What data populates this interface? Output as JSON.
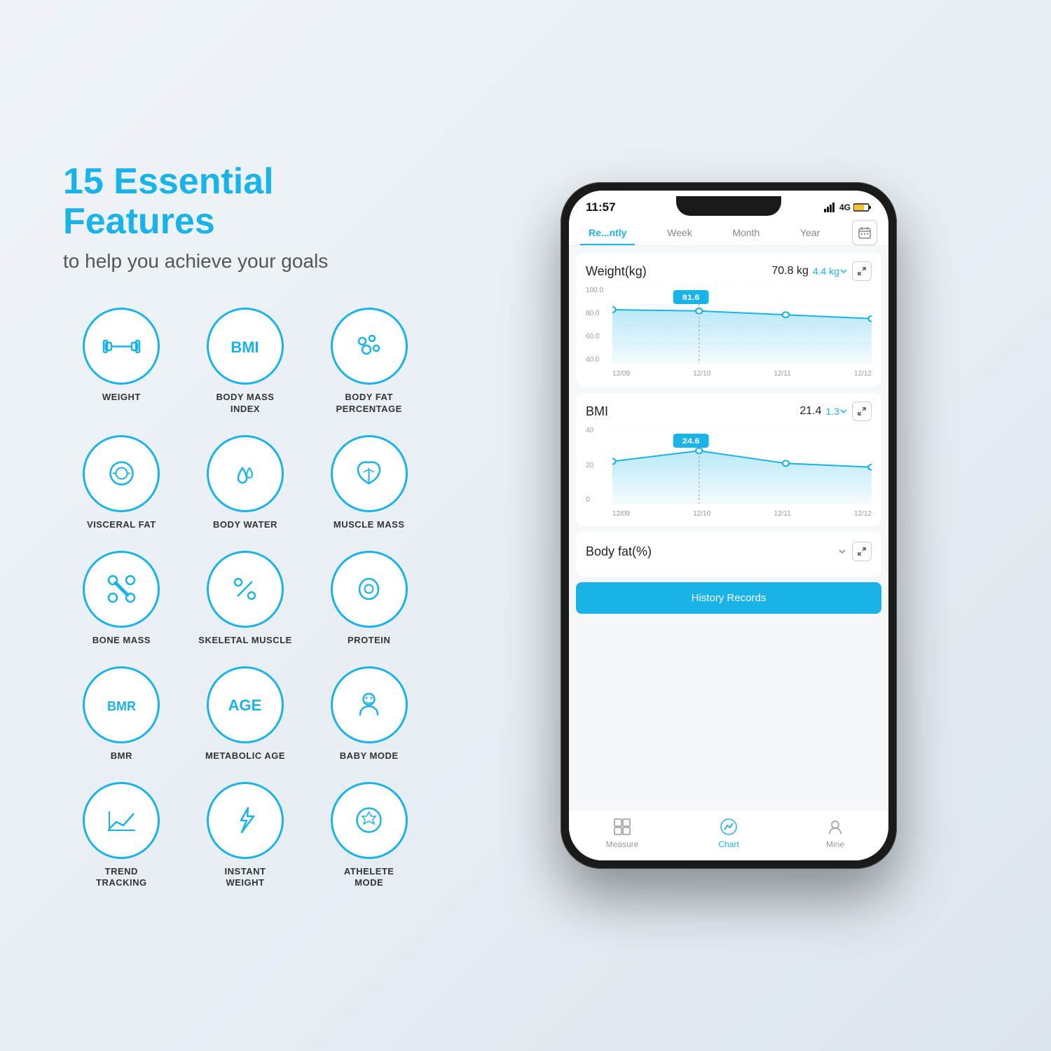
{
  "page": {
    "bg_note": "light gray gradient background"
  },
  "left": {
    "headline": "15 Essential Features",
    "subheadline": "to help you achieve your goals",
    "features": [
      {
        "id": "weight",
        "label": "WEIGHT",
        "icon": "barbell"
      },
      {
        "id": "bmi",
        "label": "BODY MASS\nINDEX",
        "icon": "BMI"
      },
      {
        "id": "bodyfat",
        "label": "BODY FAT\nPERCENTAGE",
        "icon": "dots"
      },
      {
        "id": "visceralfat",
        "label": "VISCERAL FAT",
        "icon": "tape"
      },
      {
        "id": "bodywater",
        "label": "BODY WATER",
        "icon": "drops"
      },
      {
        "id": "musclemass",
        "label": "MUSCLE MASS",
        "icon": "leaf"
      },
      {
        "id": "bonemass",
        "label": "BONE MASS",
        "icon": "bone"
      },
      {
        "id": "skeletal",
        "label": "SKELETAL MUSCLE",
        "icon": "percent"
      },
      {
        "id": "protein",
        "label": "PROTEIN",
        "icon": "egg"
      },
      {
        "id": "bmr",
        "label": "BMR",
        "icon": "BMR"
      },
      {
        "id": "age",
        "label": "METABOLIC AGE",
        "icon": "AGE"
      },
      {
        "id": "baby",
        "label": "BABY MODE",
        "icon": "baby"
      },
      {
        "id": "trend",
        "label": "TREND\nTRACKING",
        "icon": "chart"
      },
      {
        "id": "instant",
        "label": "INSTANT\nWEIGHT",
        "icon": "bolt"
      },
      {
        "id": "athlete",
        "label": "ATHELETE\nMODE",
        "icon": "soccer"
      }
    ]
  },
  "phone": {
    "status_time": "11:57",
    "signal": "4G",
    "battery": "🔋",
    "tabs": [
      {
        "label": "Re...ntly",
        "active": true
      },
      {
        "label": "Week",
        "active": false
      },
      {
        "label": "Month",
        "active": false
      },
      {
        "label": "Year",
        "active": false
      }
    ],
    "weight_chart": {
      "title": "Weight(kg)",
      "value": "70.8 kg",
      "change": "4.4 kg",
      "y_labels": [
        "100.0",
        "80.0",
        "60.0",
        "40.0"
      ],
      "x_labels": [
        "12/09",
        "12/10",
        "12/11",
        "12/12"
      ],
      "peak_label": "81.6",
      "data_points": [
        82,
        81,
        78,
        75
      ]
    },
    "bmi_chart": {
      "title": "BMI",
      "value": "21.4",
      "change": "1.3",
      "y_labels": [
        "40",
        "20",
        "0"
      ],
      "x_labels": [
        "12/09",
        "12/10",
        "12/11",
        "12/12"
      ],
      "peak_label": "24.6",
      "data_points": [
        22,
        24.5,
        21,
        19
      ]
    },
    "bodyfat": {
      "title": "Body fat(%)"
    },
    "history_btn": "History Records",
    "nav": [
      {
        "label": "Measure",
        "active": false,
        "icon": "grid"
      },
      {
        "label": "Chart",
        "active": true,
        "icon": "chart-line"
      },
      {
        "label": "Mine",
        "active": false,
        "icon": "person"
      }
    ]
  }
}
